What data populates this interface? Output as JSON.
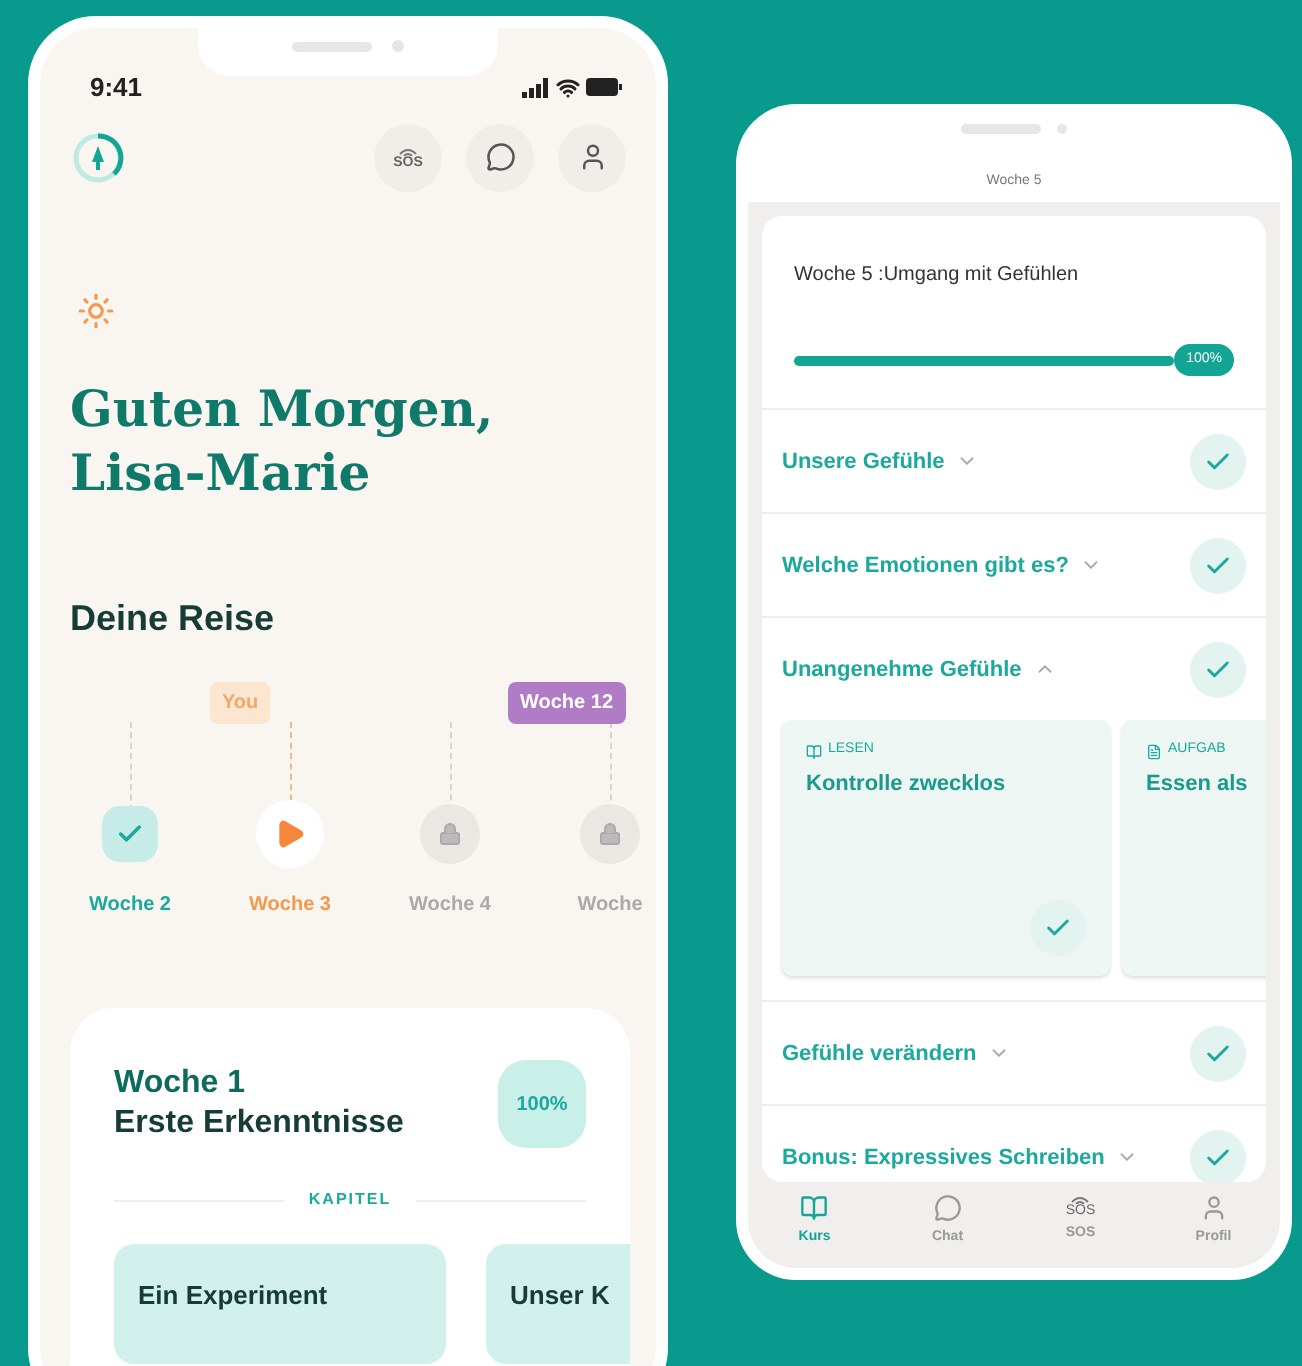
{
  "home": {
    "status_bar": {
      "time": "9:41"
    },
    "header_actions": [
      {
        "kind": "sos",
        "text": "SOS"
      },
      {
        "kind": "chat"
      },
      {
        "kind": "profile"
      }
    ],
    "greeting_lines": [
      "Guten Morgen,",
      "Lisa-Marie"
    ],
    "journey": {
      "title": "Deine Reise",
      "you_marker": "You",
      "goal_marker": "Woche 12",
      "weeks": [
        {
          "label": "Woche 2",
          "kind": "done"
        },
        {
          "label": "Woche 3",
          "kind": "current"
        },
        {
          "label": "Woche 4",
          "kind": "locked"
        },
        {
          "label": "Woche",
          "kind": "locked"
        }
      ]
    },
    "week_card": {
      "title": "Woche 1",
      "subtitle": "Erste Erkenntnisse",
      "progress": "100%",
      "section_label": "KAPITEL",
      "chapters": [
        "Ein Experiment",
        "Unser K"
      ]
    }
  },
  "course": {
    "header": {
      "subtitle": "Woche 5"
    },
    "card_title": "Woche 5 :Umgang mit Gefühlen",
    "level": 1,
    "progress_label": "100%",
    "chapters": [
      {
        "title": "Unsere Gefühle",
        "expanded": false,
        "done": true
      },
      {
        "title": "Welche Emotionen gibt es?",
        "expanded": false,
        "done": true
      },
      {
        "title": "Unangenehme Gefühle",
        "expanded": true,
        "done": true,
        "lessons": [
          {
            "kind": "read",
            "type_label": "LESEN",
            "title": "Kontrolle zwecklos",
            "done": true
          },
          {
            "kind": "task",
            "type_label": "AUFGAB",
            "title": "Essen als"
          }
        ]
      },
      {
        "title": "Gefühle verändern",
        "expanded": false,
        "done": true
      },
      {
        "title": "Bonus: Expressives Schreiben",
        "expanded": false,
        "done": true
      }
    ],
    "nav": [
      {
        "kind": "book",
        "label": "Kurs",
        "selected": true
      },
      {
        "kind": "chat",
        "label": "Chat",
        "selected": false
      },
      {
        "kind": "sos",
        "icon_text": "SOS",
        "label": "SOS",
        "selected": false
      },
      {
        "kind": "profile",
        "label": "Profil",
        "selected": false
      }
    ]
  }
}
